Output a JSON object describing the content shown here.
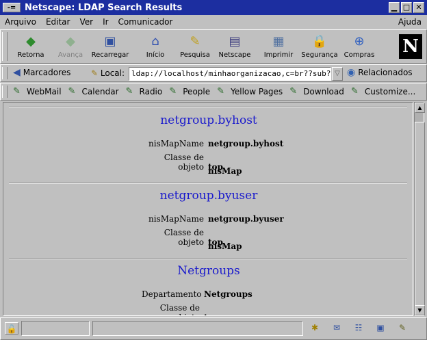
{
  "window": {
    "title": "Netscape: LDAP Search Results",
    "menu_icon": "-=",
    "buttons": [
      "▁",
      "□",
      "✕"
    ]
  },
  "menu": {
    "items": [
      "Arquivo",
      "Editar",
      "Ver",
      "Ir",
      "Comunicador"
    ],
    "help": "Ajuda"
  },
  "toolbar": {
    "buttons": [
      {
        "label": "Retorna",
        "icon": "back-arrow-icon",
        "glyph": "◆",
        "color": "#2e8b2e"
      },
      {
        "label": "Avança",
        "icon": "forward-arrow-icon",
        "glyph": "◆",
        "color": "#8fb08f"
      },
      {
        "label": "Recarregar",
        "icon": "reload-icon",
        "glyph": "▣",
        "color": "#3050a0"
      },
      {
        "label": "Início",
        "icon": "home-icon",
        "glyph": "⌂",
        "color": "#3050b0"
      },
      {
        "label": "Pesquisa",
        "icon": "search-icon",
        "glyph": "✎",
        "color": "#c0a020"
      },
      {
        "label": "Netscape",
        "icon": "netscape-icon",
        "glyph": "▤",
        "color": "#404080"
      },
      {
        "label": "Imprimir",
        "icon": "print-icon",
        "glyph": "▦",
        "color": "#5070a0"
      },
      {
        "label": "Segurança",
        "icon": "security-lock-icon",
        "glyph": "🔒",
        "color": "#a06020"
      },
      {
        "label": "Compras",
        "icon": "shopping-icon",
        "glyph": "⊕",
        "color": "#3060c0"
      }
    ],
    "logo_letter": "N"
  },
  "location": {
    "bookmarks_label": "Marcadores",
    "local_label": "Local:",
    "url": "ldap://localhost/minhaorganizacao,c=br??sub?",
    "related_label": "Relacionados"
  },
  "personal": {
    "items": [
      "WebMail",
      "Calendar",
      "Radio",
      "People",
      "Yellow Pages",
      "Download",
      "Customize..."
    ]
  },
  "entries": [
    {
      "title": "netgroup.byhost",
      "rows": [
        {
          "key": "nisMapName",
          "value": "netgroup.byhost"
        },
        {
          "key": "Classe de objeto",
          "value": "top"
        },
        {
          "key": "",
          "value": "nisMap"
        }
      ]
    },
    {
      "title": "netgroup.byuser",
      "rows": [
        {
          "key": "nisMapName",
          "value": "netgroup.byuser"
        },
        {
          "key": "Classe de objeto",
          "value": "top"
        },
        {
          "key": "",
          "value": "nisMap"
        }
      ]
    },
    {
      "title": "Netgroups",
      "rows": [
        {
          "key": "Departamento",
          "value": "Netgroups"
        },
        {
          "key": "Classe de objeto",
          "value": "top"
        }
      ]
    }
  ]
}
